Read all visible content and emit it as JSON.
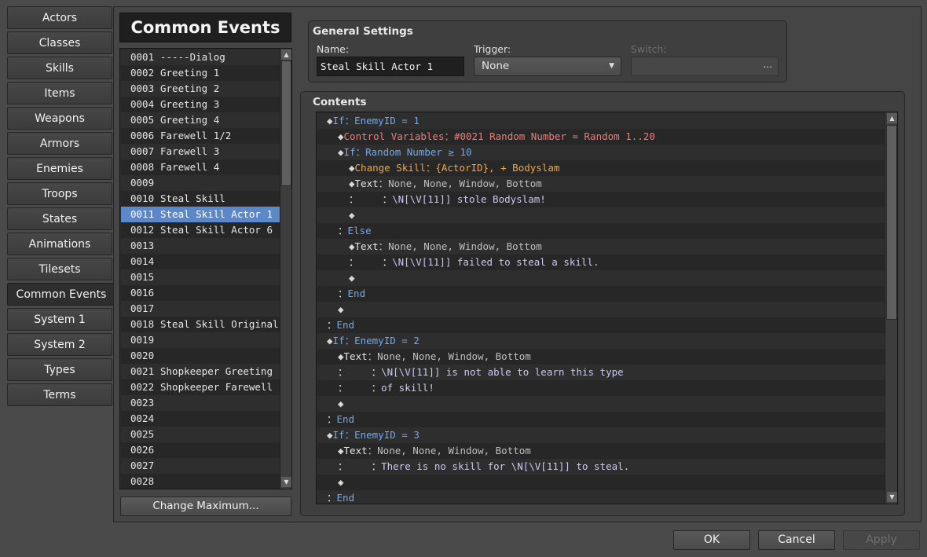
{
  "sidebar": {
    "items": [
      {
        "label": "Actors"
      },
      {
        "label": "Classes"
      },
      {
        "label": "Skills"
      },
      {
        "label": "Items"
      },
      {
        "label": "Weapons"
      },
      {
        "label": "Armors"
      },
      {
        "label": "Enemies"
      },
      {
        "label": "Troops"
      },
      {
        "label": "States"
      },
      {
        "label": "Animations"
      },
      {
        "label": "Tilesets"
      },
      {
        "label": "Common Events"
      },
      {
        "label": "System 1"
      },
      {
        "label": "System 2"
      },
      {
        "label": "Types"
      },
      {
        "label": "Terms"
      }
    ],
    "active": "Common Events"
  },
  "list_panel": {
    "title": "Common Events",
    "change_max_label": "Change Maximum...",
    "selected_number": "0011",
    "events": [
      {
        "num": "0001",
        "name": "-----Dialog"
      },
      {
        "num": "0002",
        "name": "Greeting 1"
      },
      {
        "num": "0003",
        "name": "Greeting 2"
      },
      {
        "num": "0004",
        "name": "Greeting 3"
      },
      {
        "num": "0005",
        "name": "Greeting 4"
      },
      {
        "num": "0006",
        "name": "Farewell 1/2"
      },
      {
        "num": "0007",
        "name": "Farewell 3"
      },
      {
        "num": "0008",
        "name": "Farewell 4"
      },
      {
        "num": "0009",
        "name": ""
      },
      {
        "num": "0010",
        "name": "Steal Skill"
      },
      {
        "num": "0011",
        "name": "Steal Skill Actor 1"
      },
      {
        "num": "0012",
        "name": "Steal Skill Actor 6"
      },
      {
        "num": "0013",
        "name": ""
      },
      {
        "num": "0014",
        "name": ""
      },
      {
        "num": "0015",
        "name": ""
      },
      {
        "num": "0016",
        "name": ""
      },
      {
        "num": "0017",
        "name": ""
      },
      {
        "num": "0018",
        "name": "Steal Skill Original"
      },
      {
        "num": "0019",
        "name": ""
      },
      {
        "num": "0020",
        "name": ""
      },
      {
        "num": "0021",
        "name": "Shopkeeper Greeting"
      },
      {
        "num": "0022",
        "name": "Shopkeeper Farewell"
      },
      {
        "num": "0023",
        "name": ""
      },
      {
        "num": "0024",
        "name": ""
      },
      {
        "num": "0025",
        "name": ""
      },
      {
        "num": "0026",
        "name": ""
      },
      {
        "num": "0027",
        "name": ""
      },
      {
        "num": "0028",
        "name": ""
      }
    ]
  },
  "general": {
    "title": "General Settings",
    "name_label": "Name:",
    "name_value": "Steal Skill Actor 1",
    "trigger_label": "Trigger:",
    "trigger_value": "None",
    "switch_label": "Switch:",
    "switch_button": "..."
  },
  "contents": {
    "title": "Contents",
    "commands": [
      {
        "indent": 0,
        "parts": [
          {
            "t": "◆",
            "c": "diamond"
          },
          {
            "t": "If：EnemyID = 1",
            "c": "c-blue"
          }
        ]
      },
      {
        "indent": 1,
        "parts": [
          {
            "t": "◆",
            "c": "diamond"
          },
          {
            "t": "Control Variables：#0021 Random Number = Random 1..20",
            "c": "c-red"
          }
        ]
      },
      {
        "indent": 1,
        "parts": [
          {
            "t": "◆",
            "c": "diamond"
          },
          {
            "t": "If：Random Number ≥ 10",
            "c": "c-blue"
          }
        ]
      },
      {
        "indent": 2,
        "parts": [
          {
            "t": "◆",
            "c": "diamond"
          },
          {
            "t": "Change Skill：{ActorID}, + Bodyslam",
            "c": "c-orange"
          }
        ]
      },
      {
        "indent": 2,
        "parts": [
          {
            "t": "◆",
            "c": "diamond"
          },
          {
            "t": "Text",
            "c": "c-white"
          },
          {
            "t": "：None, None, Window, Bottom",
            "c": "c-gray"
          }
        ]
      },
      {
        "indent": 2,
        "parts": [
          {
            "t": "：    ：",
            "c": "c-white"
          },
          {
            "t": "\\N[\\V[11]] stole Bodyslam!",
            "c": "c-text"
          }
        ]
      },
      {
        "indent": 2,
        "parts": [
          {
            "t": "◆",
            "c": "diamond"
          }
        ]
      },
      {
        "indent": 1,
        "parts": [
          {
            "t": "：",
            "c": "c-white"
          },
          {
            "t": "Else",
            "c": "c-blue"
          }
        ]
      },
      {
        "indent": 2,
        "parts": [
          {
            "t": "◆",
            "c": "diamond"
          },
          {
            "t": "Text",
            "c": "c-white"
          },
          {
            "t": "：None, None, Window, Bottom",
            "c": "c-gray"
          }
        ]
      },
      {
        "indent": 2,
        "parts": [
          {
            "t": "：    ：",
            "c": "c-white"
          },
          {
            "t": "\\N[\\V[11]] failed to steal a skill.",
            "c": "c-text"
          }
        ]
      },
      {
        "indent": 2,
        "parts": [
          {
            "t": "◆",
            "c": "diamond"
          }
        ]
      },
      {
        "indent": 1,
        "parts": [
          {
            "t": "：",
            "c": "c-white"
          },
          {
            "t": "End",
            "c": "c-blue"
          }
        ]
      },
      {
        "indent": 1,
        "parts": [
          {
            "t": "◆",
            "c": "diamond"
          }
        ]
      },
      {
        "indent": 0,
        "parts": [
          {
            "t": "：",
            "c": "c-white"
          },
          {
            "t": "End",
            "c": "c-blue"
          }
        ]
      },
      {
        "indent": 0,
        "parts": [
          {
            "t": "◆",
            "c": "diamond"
          },
          {
            "t": "If：EnemyID = 2",
            "c": "c-blue"
          }
        ]
      },
      {
        "indent": 1,
        "parts": [
          {
            "t": "◆",
            "c": "diamond"
          },
          {
            "t": "Text",
            "c": "c-white"
          },
          {
            "t": "：None, None, Window, Bottom",
            "c": "c-gray"
          }
        ]
      },
      {
        "indent": 1,
        "parts": [
          {
            "t": "：    ：",
            "c": "c-white"
          },
          {
            "t": "\\N[\\V[11]] is not able to learn this type",
            "c": "c-text"
          }
        ]
      },
      {
        "indent": 1,
        "parts": [
          {
            "t": "：    ：",
            "c": "c-white"
          },
          {
            "t": "of skill!",
            "c": "c-text"
          }
        ]
      },
      {
        "indent": 1,
        "parts": [
          {
            "t": "◆",
            "c": "diamond"
          }
        ]
      },
      {
        "indent": 0,
        "parts": [
          {
            "t": "：",
            "c": "c-white"
          },
          {
            "t": "End",
            "c": "c-blue"
          }
        ]
      },
      {
        "indent": 0,
        "parts": [
          {
            "t": "◆",
            "c": "diamond"
          },
          {
            "t": "If：EnemyID = 3",
            "c": "c-blue"
          }
        ]
      },
      {
        "indent": 1,
        "parts": [
          {
            "t": "◆",
            "c": "diamond"
          },
          {
            "t": "Text",
            "c": "c-white"
          },
          {
            "t": "：None, None, Window, Bottom",
            "c": "c-gray"
          }
        ]
      },
      {
        "indent": 1,
        "parts": [
          {
            "t": "：    ：",
            "c": "c-white"
          },
          {
            "t": "There is no skill for \\N[\\V[11]] to steal.",
            "c": "c-text"
          }
        ]
      },
      {
        "indent": 1,
        "parts": [
          {
            "t": "◆",
            "c": "diamond"
          }
        ]
      },
      {
        "indent": 0,
        "parts": [
          {
            "t": "：",
            "c": "c-white"
          },
          {
            "t": "End",
            "c": "c-blue"
          }
        ]
      }
    ]
  },
  "buttons": {
    "ok": "OK",
    "cancel": "Cancel",
    "apply": "Apply"
  },
  "colors": {
    "selection": "#5c88c9",
    "background": "#4a4a4a",
    "command_blue": "#6fa9ec",
    "command_red": "#f07a7a",
    "command_orange": "#f1a544"
  }
}
